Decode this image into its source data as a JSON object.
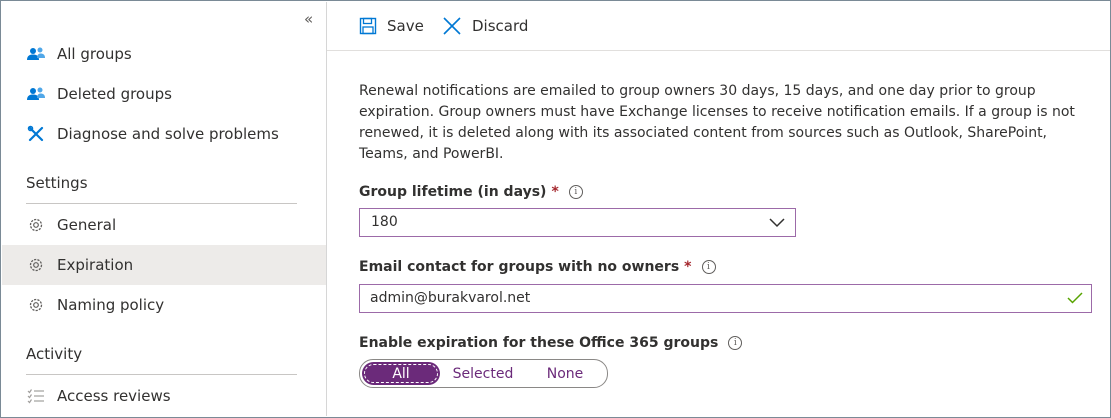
{
  "sidebar": {
    "collapse_glyph": "«",
    "items": [
      {
        "label": "All groups",
        "icon": "groups-icon"
      },
      {
        "label": "Deleted groups",
        "icon": "groups-icon"
      },
      {
        "label": "Diagnose and solve problems",
        "icon": "wrench-icon"
      }
    ],
    "settings": {
      "title": "Settings",
      "items": [
        {
          "label": "General",
          "icon": "gear-icon"
        },
        {
          "label": "Expiration",
          "icon": "gear-icon",
          "active": true
        },
        {
          "label": "Naming policy",
          "icon": "gear-icon"
        }
      ]
    },
    "activity": {
      "title": "Activity",
      "items": [
        {
          "label": "Access reviews",
          "icon": "list-icon"
        }
      ]
    }
  },
  "toolbar": {
    "save_label": "Save",
    "discard_label": "Discard"
  },
  "main": {
    "description": "Renewal notifications are emailed to group owners 30 days, 15 days, and one day prior to group expiration. Group owners must have Exchange licenses to receive notification emails. If a group is not renewed, it is deleted along with its associated content from sources such as Outlook, SharePoint, Teams, and PowerBI.",
    "lifetime": {
      "label": "Group lifetime (in days)",
      "required": "*",
      "value": "180"
    },
    "email": {
      "label": "Email contact for groups with no owners",
      "required": "*",
      "value": "admin@burakvarol.net"
    },
    "enable": {
      "label": "Enable expiration for these Office 365 groups",
      "options": [
        "All",
        "Selected",
        "None"
      ],
      "selected": "All"
    },
    "info_glyph": "i"
  },
  "colors": {
    "accent": "#6b2a7a",
    "icon_blue": "#0078d4",
    "required_red": "#a4262c",
    "valid_green": "#57a300",
    "active_bg": "#edebe9"
  }
}
